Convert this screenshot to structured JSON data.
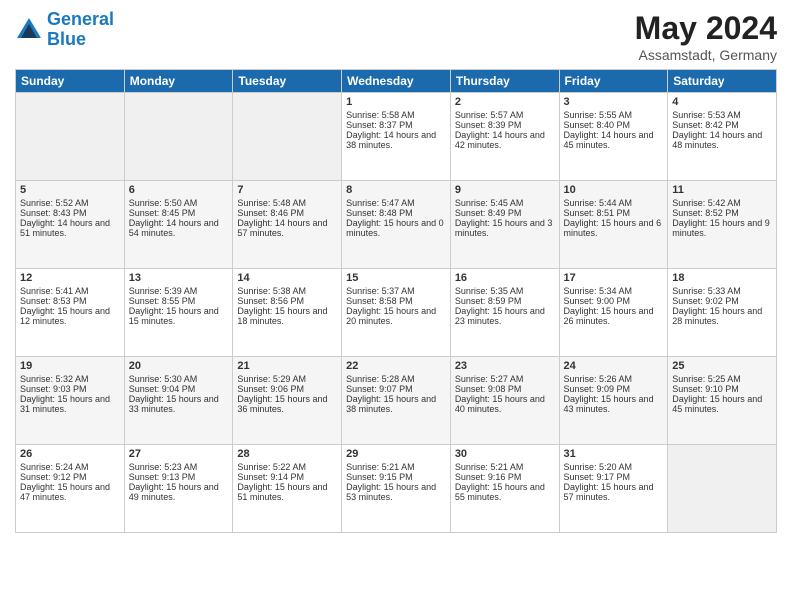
{
  "header": {
    "logo_line1": "General",
    "logo_line2": "Blue",
    "month_year": "May 2024",
    "location": "Assamstadt, Germany"
  },
  "days_of_week": [
    "Sunday",
    "Monday",
    "Tuesday",
    "Wednesday",
    "Thursday",
    "Friday",
    "Saturday"
  ],
  "weeks": [
    {
      "cells": [
        {
          "empty": true
        },
        {
          "empty": true
        },
        {
          "empty": true
        },
        {
          "day": "1",
          "sunrise": "5:58 AM",
          "sunset": "8:37 PM",
          "daylight": "14 hours and 38 minutes."
        },
        {
          "day": "2",
          "sunrise": "5:57 AM",
          "sunset": "8:39 PM",
          "daylight": "14 hours and 42 minutes."
        },
        {
          "day": "3",
          "sunrise": "5:55 AM",
          "sunset": "8:40 PM",
          "daylight": "14 hours and 45 minutes."
        },
        {
          "day": "4",
          "sunrise": "5:53 AM",
          "sunset": "8:42 PM",
          "daylight": "14 hours and 48 minutes."
        }
      ]
    },
    {
      "cells": [
        {
          "day": "5",
          "sunrise": "5:52 AM",
          "sunset": "8:43 PM",
          "daylight": "14 hours and 51 minutes."
        },
        {
          "day": "6",
          "sunrise": "5:50 AM",
          "sunset": "8:45 PM",
          "daylight": "14 hours and 54 minutes."
        },
        {
          "day": "7",
          "sunrise": "5:48 AM",
          "sunset": "8:46 PM",
          "daylight": "14 hours and 57 minutes."
        },
        {
          "day": "8",
          "sunrise": "5:47 AM",
          "sunset": "8:48 PM",
          "daylight": "15 hours and 0 minutes."
        },
        {
          "day": "9",
          "sunrise": "5:45 AM",
          "sunset": "8:49 PM",
          "daylight": "15 hours and 3 minutes."
        },
        {
          "day": "10",
          "sunrise": "5:44 AM",
          "sunset": "8:51 PM",
          "daylight": "15 hours and 6 minutes."
        },
        {
          "day": "11",
          "sunrise": "5:42 AM",
          "sunset": "8:52 PM",
          "daylight": "15 hours and 9 minutes."
        }
      ]
    },
    {
      "cells": [
        {
          "day": "12",
          "sunrise": "5:41 AM",
          "sunset": "8:53 PM",
          "daylight": "15 hours and 12 minutes."
        },
        {
          "day": "13",
          "sunrise": "5:39 AM",
          "sunset": "8:55 PM",
          "daylight": "15 hours and 15 minutes."
        },
        {
          "day": "14",
          "sunrise": "5:38 AM",
          "sunset": "8:56 PM",
          "daylight": "15 hours and 18 minutes."
        },
        {
          "day": "15",
          "sunrise": "5:37 AM",
          "sunset": "8:58 PM",
          "daylight": "15 hours and 20 minutes."
        },
        {
          "day": "16",
          "sunrise": "5:35 AM",
          "sunset": "8:59 PM",
          "daylight": "15 hours and 23 minutes."
        },
        {
          "day": "17",
          "sunrise": "5:34 AM",
          "sunset": "9:00 PM",
          "daylight": "15 hours and 26 minutes."
        },
        {
          "day": "18",
          "sunrise": "5:33 AM",
          "sunset": "9:02 PM",
          "daylight": "15 hours and 28 minutes."
        }
      ]
    },
    {
      "cells": [
        {
          "day": "19",
          "sunrise": "5:32 AM",
          "sunset": "9:03 PM",
          "daylight": "15 hours and 31 minutes."
        },
        {
          "day": "20",
          "sunrise": "5:30 AM",
          "sunset": "9:04 PM",
          "daylight": "15 hours and 33 minutes."
        },
        {
          "day": "21",
          "sunrise": "5:29 AM",
          "sunset": "9:06 PM",
          "daylight": "15 hours and 36 minutes."
        },
        {
          "day": "22",
          "sunrise": "5:28 AM",
          "sunset": "9:07 PM",
          "daylight": "15 hours and 38 minutes."
        },
        {
          "day": "23",
          "sunrise": "5:27 AM",
          "sunset": "9:08 PM",
          "daylight": "15 hours and 40 minutes."
        },
        {
          "day": "24",
          "sunrise": "5:26 AM",
          "sunset": "9:09 PM",
          "daylight": "15 hours and 43 minutes."
        },
        {
          "day": "25",
          "sunrise": "5:25 AM",
          "sunset": "9:10 PM",
          "daylight": "15 hours and 45 minutes."
        }
      ]
    },
    {
      "cells": [
        {
          "day": "26",
          "sunrise": "5:24 AM",
          "sunset": "9:12 PM",
          "daylight": "15 hours and 47 minutes."
        },
        {
          "day": "27",
          "sunrise": "5:23 AM",
          "sunset": "9:13 PM",
          "daylight": "15 hours and 49 minutes."
        },
        {
          "day": "28",
          "sunrise": "5:22 AM",
          "sunset": "9:14 PM",
          "daylight": "15 hours and 51 minutes."
        },
        {
          "day": "29",
          "sunrise": "5:21 AM",
          "sunset": "9:15 PM",
          "daylight": "15 hours and 53 minutes."
        },
        {
          "day": "30",
          "sunrise": "5:21 AM",
          "sunset": "9:16 PM",
          "daylight": "15 hours and 55 minutes."
        },
        {
          "day": "31",
          "sunrise": "5:20 AM",
          "sunset": "9:17 PM",
          "daylight": "15 hours and 57 minutes."
        },
        {
          "empty": true
        }
      ]
    }
  ]
}
